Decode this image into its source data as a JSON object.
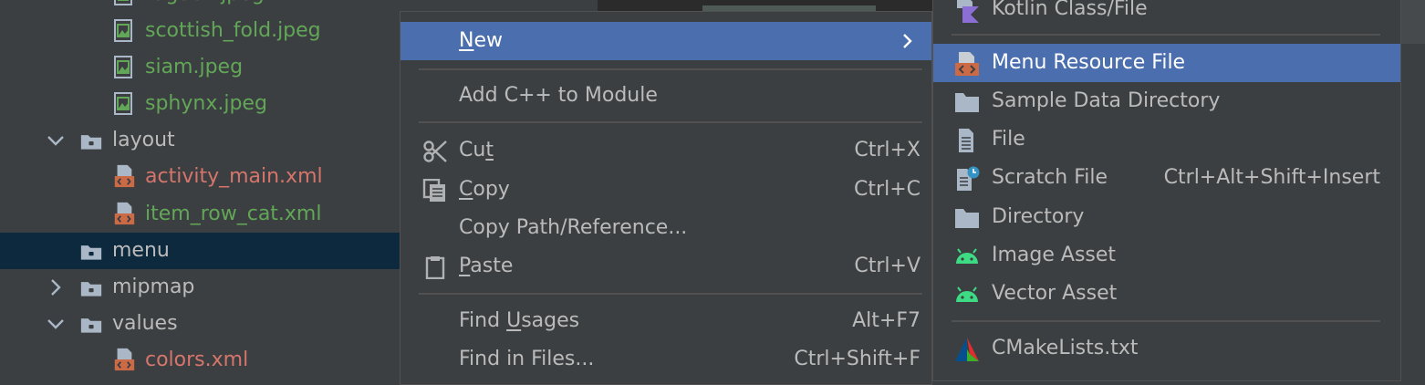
{
  "tree": {
    "items": [
      {
        "label": "ragdoll.jpeg",
        "type": "image",
        "color": "green"
      },
      {
        "label": "scottish_fold.jpeg",
        "type": "image",
        "color": "green"
      },
      {
        "label": "siam.jpeg",
        "type": "image",
        "color": "green"
      },
      {
        "label": "sphynx.jpeg",
        "type": "image",
        "color": "green"
      },
      {
        "label": "layout",
        "type": "folder",
        "expanded": true
      },
      {
        "label": "activity_main.xml",
        "type": "xml",
        "color": "red"
      },
      {
        "label": "item_row_cat.xml",
        "type": "xml",
        "color": "green"
      },
      {
        "label": "menu",
        "type": "folder",
        "selected": true
      },
      {
        "label": "mipmap",
        "type": "folder",
        "expanded": false
      },
      {
        "label": "values",
        "type": "folder",
        "expanded": true
      },
      {
        "label": "colors.xml",
        "type": "xml",
        "color": "red"
      }
    ]
  },
  "context_menu": {
    "new": {
      "label": "New",
      "mnemonic": "N",
      "rest": "ew"
    },
    "add_cpp": {
      "label": "Add C++ to Module"
    },
    "cut": {
      "pre": "Cu",
      "mnemonic": "t",
      "post": "",
      "shortcut": "Ctrl+X"
    },
    "copy": {
      "pre": "",
      "mnemonic": "C",
      "post": "opy",
      "shortcut": "Ctrl+C"
    },
    "copy_path": {
      "label": "Copy Path/Reference..."
    },
    "paste": {
      "pre": "",
      "mnemonic": "P",
      "post": "aste",
      "shortcut": "Ctrl+V"
    },
    "find_usages": {
      "pre": "Find ",
      "mnemonic": "U",
      "post": "sages",
      "shortcut": "Alt+F7"
    },
    "find_in_files": {
      "label": "Find in Files...",
      "shortcut": "Ctrl+Shift+F"
    }
  },
  "submenu": {
    "items": [
      {
        "key": "kotlin",
        "label": "Kotlin Class/File",
        "icon": "kotlin-file-icon"
      },
      {
        "key": "menu_resource",
        "label": "Menu Resource File",
        "icon": "xml-resource-icon",
        "highlighted": true
      },
      {
        "key": "sample_dir",
        "label": "Sample Data Directory",
        "icon": "folder-icon"
      },
      {
        "key": "file",
        "label": "File",
        "icon": "file-icon"
      },
      {
        "key": "scratch",
        "label": "Scratch File",
        "icon": "scratch-file-icon",
        "shortcut": "Ctrl+Alt+Shift+Insert"
      },
      {
        "key": "directory",
        "label": "Directory",
        "icon": "folder-icon"
      },
      {
        "key": "image_asset",
        "label": "Image Asset",
        "icon": "android-icon"
      },
      {
        "key": "vector_asset",
        "label": "Vector Asset",
        "icon": "android-icon"
      },
      {
        "key": "cmake",
        "label": "CMakeLists.txt",
        "icon": "cmake-icon"
      }
    ]
  },
  "colors": {
    "background": "#3c3f41",
    "selection": "#4b6eaf",
    "tree_selection": "#0d293e",
    "green_file": "#62a657",
    "red_file": "#d5756c",
    "android": "#3ddc84"
  }
}
